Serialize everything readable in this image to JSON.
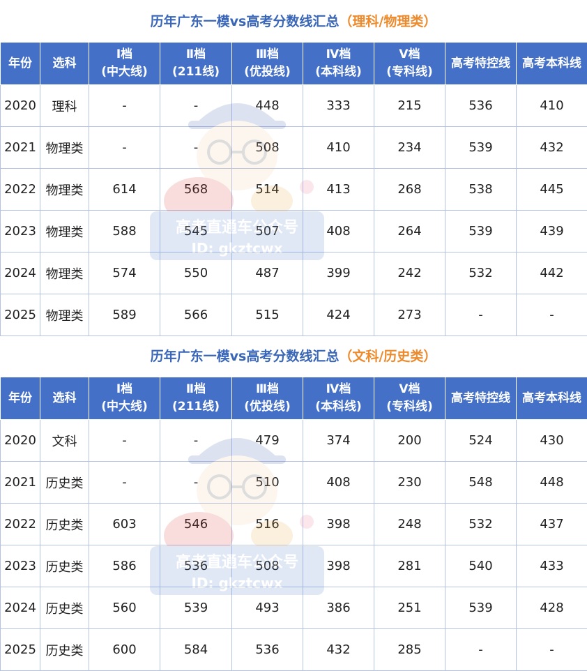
{
  "tables": [
    {
      "title_main": "历年广东一模vs高考分数线汇总",
      "title_accent": "（理科/物理类）",
      "headers": [
        {
          "line1": "年份",
          "line2": ""
        },
        {
          "line1": "选科",
          "line2": ""
        },
        {
          "line1": "Ⅰ档",
          "line2": "(中大线)"
        },
        {
          "line1": "Ⅱ档",
          "line2": "(211线)"
        },
        {
          "line1": "Ⅲ档",
          "line2": "(优投线)"
        },
        {
          "line1": "Ⅳ档",
          "line2": "(本科线)"
        },
        {
          "line1": "Ⅴ档",
          "line2": "(专科线)"
        },
        {
          "line1": "高考特控线",
          "line2": ""
        },
        {
          "line1": "高考本科线",
          "line2": ""
        }
      ],
      "rows": [
        [
          "2020",
          "理科",
          "-",
          "-",
          "448",
          "333",
          "215",
          "536",
          "410"
        ],
        [
          "2021",
          "物理类",
          "-",
          "-",
          "508",
          "410",
          "234",
          "539",
          "432"
        ],
        [
          "2022",
          "物理类",
          "614",
          "568",
          "514",
          "413",
          "268",
          "538",
          "445"
        ],
        [
          "2023",
          "物理类",
          "588",
          "545",
          "507",
          "408",
          "264",
          "539",
          "439"
        ],
        [
          "2024",
          "物理类",
          "574",
          "550",
          "487",
          "399",
          "242",
          "532",
          "442"
        ],
        [
          "2025",
          "物理类",
          "589",
          "566",
          "515",
          "424",
          "273",
          "-",
          "-"
        ]
      ]
    },
    {
      "title_main": "历年广东一模vs高考分数线汇总",
      "title_accent": "（文科/历史类）",
      "headers": [
        {
          "line1": "年份",
          "line2": ""
        },
        {
          "line1": "选科",
          "line2": ""
        },
        {
          "line1": "Ⅰ档",
          "line2": "(中大线)"
        },
        {
          "line1": "Ⅱ档",
          "line2": "(211线)"
        },
        {
          "line1": "Ⅲ档",
          "line2": "(优投线)"
        },
        {
          "line1": "Ⅳ档",
          "line2": "(本科线)"
        },
        {
          "line1": "Ⅴ档",
          "line2": "(专科线)"
        },
        {
          "line1": "高考特控线",
          "line2": ""
        },
        {
          "line1": "高考本科线",
          "line2": ""
        }
      ],
      "rows": [
        [
          "2020",
          "文科",
          "-",
          "-",
          "479",
          "374",
          "200",
          "524",
          "430"
        ],
        [
          "2021",
          "历史类",
          "-",
          "-",
          "510",
          "408",
          "230",
          "548",
          "448"
        ],
        [
          "2022",
          "历史类",
          "603",
          "546",
          "516",
          "398",
          "248",
          "532",
          "437"
        ],
        [
          "2023",
          "历史类",
          "586",
          "536",
          "508",
          "398",
          "281",
          "540",
          "433"
        ],
        [
          "2024",
          "历史类",
          "560",
          "539",
          "493",
          "386",
          "251",
          "539",
          "428"
        ],
        [
          "2025",
          "历史类",
          "600",
          "584",
          "536",
          "432",
          "285",
          "-",
          "-"
        ]
      ]
    }
  ],
  "watermark": {
    "line1": "高考直通车公众号",
    "line2": "ID: gkztcwx"
  },
  "colors": {
    "title": "#3a66b8",
    "title_accent": "#ec8a2c",
    "header_bg": "#4470c8",
    "header_text": "#ffffff",
    "grid": "#b4c3e3"
  }
}
